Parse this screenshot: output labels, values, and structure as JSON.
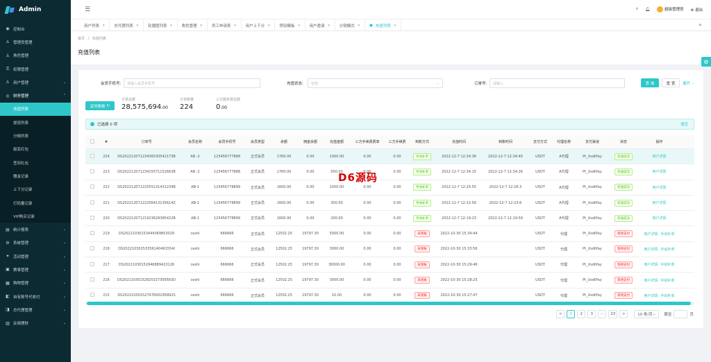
{
  "brand": "Admin",
  "sidebar": {
    "items": [
      {
        "icon": "dashboard-icon",
        "glyph": "◉",
        "label": "控制台",
        "sub": false,
        "arrow": ""
      },
      {
        "icon": "user-icon",
        "glyph": "♙",
        "label": "管理员管理",
        "sub": false,
        "arrow": ""
      },
      {
        "icon": "role-icon",
        "glyph": "♙",
        "label": "角色管理",
        "sub": false,
        "arrow": ""
      },
      {
        "icon": "permission-icon",
        "glyph": "⚿",
        "label": "权限管理",
        "sub": false,
        "arrow": ""
      },
      {
        "icon": "users-icon",
        "glyph": "♙",
        "label": "用户管理",
        "sub": false,
        "arrow": "⌄"
      },
      {
        "icon": "finance-icon",
        "glyph": "◎",
        "label": "财务管理",
        "sub": false,
        "arrow": "⌃",
        "bold": true
      },
      {
        "icon": "",
        "glyph": "",
        "label": "充值列表",
        "sub": true,
        "active": true,
        "arrow": ""
      },
      {
        "icon": "",
        "glyph": "",
        "label": "提现列表",
        "sub": true,
        "arrow": ""
      },
      {
        "icon": "",
        "glyph": "",
        "label": "分佣列表",
        "sub": true,
        "arrow": ""
      },
      {
        "icon": "",
        "glyph": "",
        "label": "裂变红包",
        "sub": true,
        "arrow": ""
      },
      {
        "icon": "",
        "glyph": "",
        "label": "签到礼包",
        "sub": true,
        "arrow": ""
      },
      {
        "icon": "",
        "glyph": "",
        "label": "赠金记录",
        "sub": true,
        "arrow": ""
      },
      {
        "icon": "",
        "glyph": "",
        "label": "上下分记录",
        "sub": true,
        "arrow": ""
      },
      {
        "icon": "",
        "glyph": "",
        "label": "打码量记录",
        "sub": true,
        "arrow": ""
      },
      {
        "icon": "",
        "glyph": "",
        "label": "VIP购买记录",
        "sub": true,
        "arrow": ""
      },
      {
        "icon": "stats-icon",
        "glyph": "▤",
        "label": "统计报表",
        "sub": false,
        "arrow": "⌄"
      },
      {
        "icon": "system-icon",
        "glyph": "⚙",
        "label": "系统管理",
        "sub": false,
        "arrow": "⌄"
      },
      {
        "icon": "activity-icon",
        "glyph": "✦",
        "label": "活动管理",
        "sub": false,
        "arrow": "⌄"
      },
      {
        "icon": "game-icon",
        "glyph": "▣",
        "label": "赛事管理",
        "sub": false,
        "arrow": "⌄"
      },
      {
        "icon": "shop-icon",
        "glyph": "▦",
        "label": "购物管理",
        "sub": false,
        "arrow": "⌄"
      },
      {
        "icon": "account-icon",
        "glyph": "◧",
        "label": "自有账号代收付",
        "sub": false,
        "arrow": "⌄"
      },
      {
        "icon": "agent-icon",
        "glyph": "◨",
        "label": "总代理管理",
        "sub": false,
        "arrow": "⌄"
      },
      {
        "icon": "weekly-icon",
        "glyph": "▥",
        "label": "反佣理财",
        "sub": false,
        "arrow": "⌄"
      }
    ]
  },
  "header": {
    "admin_name": "超级管理员",
    "logout_label": "退出"
  },
  "tabs": [
    "用户列表",
    "总代理列表",
    "轮播图列表",
    "角色管理",
    "员工申请表",
    "用户上下分",
    "预设模板",
    "用户邀请",
    "分销模式",
    "充值列表"
  ],
  "active_tab": "充值列表",
  "breadcrumb": {
    "home": "首页",
    "sep": "/",
    "current": "充值列表"
  },
  "page_title": "充值列表",
  "filters": {
    "phone_label": "会员手机号:",
    "phone_placeholder": "请输入会员手机号",
    "status_label": "充值状态:",
    "status_placeholder": "状态",
    "order_label": "订单号:",
    "order_placeholder": "请输入",
    "search_label": "查 询",
    "reset_label": "重 置",
    "expand_label": "展开"
  },
  "refresh_label": "定时刷新",
  "stats": [
    {
      "label": "订单总额",
      "value": "28,575,694",
      "suffix": ".00"
    },
    {
      "label": "订单数量",
      "value": "224",
      "suffix": ""
    },
    {
      "label": "三方服务费总额",
      "value": "0",
      "suffix": ".00"
    }
  ],
  "selection": {
    "text": "已选择 0 项",
    "clear": "清空"
  },
  "columns": [
    "#",
    "订单号",
    "会员名称",
    "会员手机号",
    "会员类型",
    "余额",
    "佣金余额",
    "充值金额",
    "三方手续费费率",
    "三方手续费",
    "到账方式",
    "充值时间",
    "到账时间",
    "支付方式",
    "代理名称",
    "支付渠道",
    "状态",
    "操作"
  ],
  "rows": [
    {
      "id": "224",
      "order": "DS20221207123436530542173B",
      "name": "AB -2",
      "phone": "123456777888",
      "type": "正式会员",
      "balance": "1760.00",
      "commission": "0.00",
      "amount": "1000.00",
      "rate": "0.00",
      "fee": "0.00",
      "method": "手动补单",
      "method_tag": "g",
      "time": "2022-12-7 12:34:36",
      "arrive": "2022-12-7 12:34:40",
      "pay": "USDT",
      "agent": "A代理",
      "channel": "Pt_UsdtPay",
      "status": "充值成功",
      "status_tag": "g",
      "ops": [
        "用户详情"
      ]
    },
    {
      "id": "223",
      "order": "DS20221207123415571152663B",
      "name": "AB -2",
      "phone": "123456777888",
      "type": "正式会员",
      "balance": "1760.00",
      "commission": "0.00",
      "amount": "500.00",
      "rate": "0.00",
      "fee": "0.00",
      "method": "手动补单",
      "method_tag": "g",
      "time": "2022-12-7 12:34:15",
      "arrive": "2022-12-7 12:34:26",
      "pay": "USDT",
      "agent": "A代理",
      "channel": "Pt_UsdtPay",
      "status": "充值成功",
      "status_tag": "g",
      "ops": [
        "用户详情"
      ]
    },
    {
      "id": "222",
      "order": "DS20221207122555131431234B",
      "name": "AB-1",
      "phone": "123456778899",
      "type": "正式会员",
      "balance": "1600.00",
      "commission": "0.00",
      "amount": "1000.00",
      "rate": "0.00",
      "fee": "0.00",
      "method": "手动补单",
      "method_tag": "g",
      "time": "2022-12-7 12:25:55",
      "arrive": "2022-12-7 12:26:3",
      "pay": "USDT",
      "agent": "A代理",
      "channel": "Pt_UsdtPay",
      "status": "充值成功",
      "status_tag": "g",
      "ops": [
        "用户详情"
      ]
    },
    {
      "id": "221",
      "order": "DS20221207122256413135614Z",
      "name": "AB-1",
      "phone": "123456778899",
      "type": "正式会员",
      "balance": "1600.00",
      "commission": "0.00",
      "amount": "300.00",
      "rate": "0.00",
      "fee": "0.00",
      "method": "手动补单",
      "method_tag": "g",
      "time": "2022-12-7 12:22:56",
      "arrive": "2022-12-7 12:23:6",
      "pay": "USDT",
      "agent": "A代理",
      "channel": "Pt_UsdtPay",
      "status": "充值成功",
      "status_tag": "g",
      "ops": [
        "用户详情"
      ]
    },
    {
      "id": "220",
      "order": "DS20221207121923628385422B",
      "name": "AB-1",
      "phone": "123456778899",
      "type": "正式会员",
      "balance": "1600.00",
      "commission": "0.00",
      "amount": "200.00",
      "rate": "0.00",
      "fee": "0.00",
      "method": "手动补单",
      "method_tag": "g",
      "time": "2022-12-7 12:19:23",
      "arrive": "2022-12-7 12:19:59",
      "pay": "USDT",
      "agent": "A代理",
      "channel": "Pt_UsdtPay",
      "status": "充值成功",
      "status_tag": "g",
      "ops": [
        "用户详情"
      ]
    },
    {
      "id": "219",
      "order": "DS20221030153444369853029",
      "name": "ceshi",
      "phone": "666666",
      "type": "正式会员",
      "balance": "12502.25",
      "commission": "19797.30",
      "amount": "5000.00",
      "rate": "0.00",
      "fee": "0.00",
      "method": "未到账",
      "method_tag": "r",
      "time": "2022-10-30 15:34:44",
      "arrive": "",
      "pay": "USDT",
      "agent": "代理",
      "channel": "Pt_UsdtPay",
      "status": "等待支付",
      "status_tag": "r",
      "ops": [
        "用户详情",
        "手动补单"
      ]
    },
    {
      "id": "218",
      "order": "DS20221030153356140461554I",
      "name": "ceshi",
      "phone": "666666",
      "type": "正式会员",
      "balance": "12502.25",
      "commission": "19797.30",
      "amount": "3000.00",
      "rate": "0.00",
      "fee": "0.00",
      "method": "未到账",
      "method_tag": "r",
      "time": "2022-10-30 15:33:56",
      "arrive": "",
      "pay": "USDT",
      "agent": "代理",
      "channel": "Pt_UsdtPay",
      "status": "等待支付",
      "status_tag": "r",
      "ops": [
        "用户详情",
        "手动补单"
      ]
    },
    {
      "id": "217",
      "order": "DS20221030152946889423126",
      "name": "ceshi",
      "phone": "666666",
      "type": "正式会员",
      "balance": "12502.25",
      "commission": "19797.30",
      "amount": "30000.00",
      "rate": "0.00",
      "fee": "0.00",
      "method": "未到账",
      "method_tag": "r",
      "time": "2022-10-30 15:29:46",
      "arrive": "",
      "pay": "USDT",
      "agent": "代理",
      "channel": "Pt_UsdtPay",
      "status": "等待支付",
      "status_tag": "r",
      "ops": [
        "用户详情",
        "手动补单"
      ]
    },
    {
      "id": "216",
      "order": "DS20221030152825327309583D",
      "name": "ceshi",
      "phone": "666666",
      "type": "正式会员",
      "balance": "12502.25",
      "commission": "19797.30",
      "amount": "3000.00",
      "rate": "0.00",
      "fee": "0.00",
      "method": "未到账",
      "method_tag": "r",
      "time": "2022-10-30 15:28:25",
      "arrive": "",
      "pay": "USDT",
      "agent": "代理",
      "channel": "Pt_UsdtPay",
      "status": "等待支付",
      "status_tag": "r",
      "ops": [
        "用户详情",
        "手动补单"
      ]
    },
    {
      "id": "215",
      "order": "DS20221030152747600295892S",
      "name": "ceshi",
      "phone": "666666",
      "type": "正式会员",
      "balance": "12502.25",
      "commission": "19797.30",
      "amount": "10.00",
      "rate": "0.00",
      "fee": "0.00",
      "method": "未到账",
      "method_tag": "r",
      "time": "2022-10-30 15:27:47",
      "arrive": "",
      "pay": "USDT",
      "agent": "代理",
      "channel": "Pt_UsdtPay",
      "status": "等待支付",
      "status_tag": "r",
      "ops": [
        "用户详情",
        "手动补单"
      ]
    }
  ],
  "pagination": {
    "prev": "<",
    "pages": [
      "1",
      "2",
      "3",
      "···",
      "23"
    ],
    "current": "1",
    "next": ">",
    "size": "10 条/页",
    "jump_label": "跳至",
    "page_suffix": "页"
  },
  "watermark": "D6源码",
  "colors": {
    "accent": "#2ec7c9",
    "sidebar": "#0c2a32",
    "success": "#52c41a",
    "danger": "#f5222d"
  }
}
